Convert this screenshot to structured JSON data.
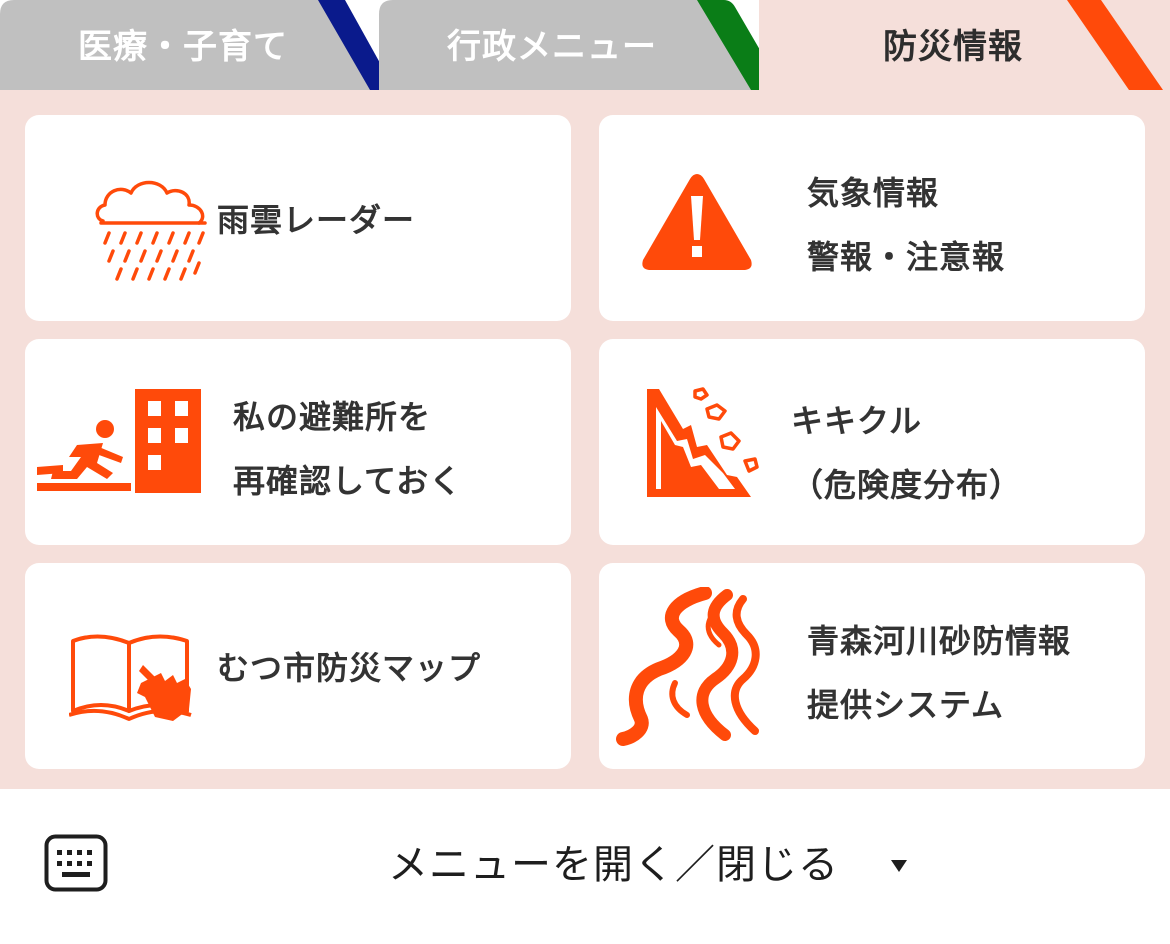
{
  "tabs": [
    {
      "label": "医療・子育て",
      "accent": "#0a1a8c",
      "active": false
    },
    {
      "label": "行政メニュー",
      "accent": "#0a7d17",
      "active": false
    },
    {
      "label": "防災情報",
      "accent": "#ff4a0a",
      "active": true
    }
  ],
  "colors": {
    "inactive_tab": "#c0c0c0",
    "active_tab": "#f5dfda",
    "panel_bg": "#f5dfda",
    "card_bg": "#ffffff",
    "icon": "#ff4a0a",
    "text": "#333333"
  },
  "cards": [
    {
      "icon": "rain-cloud-icon",
      "lines": [
        "雨雲レーダー"
      ]
    },
    {
      "icon": "warning-triangle-icon",
      "lines": [
        "気象情報",
        "警報・注意報"
      ]
    },
    {
      "icon": "evacuation-icon",
      "lines": [
        "私の避難所を",
        "再確認しておく"
      ]
    },
    {
      "icon": "landslide-icon",
      "lines": [
        "キキクル",
        "（危険度分布）"
      ]
    },
    {
      "icon": "map-book-icon",
      "lines": [
        "むつ市防災マップ"
      ]
    },
    {
      "icon": "river-icon",
      "lines": [
        "青森河川砂防情報",
        "提供システム"
      ]
    }
  ],
  "bottom_bar": {
    "icon": "keyboard-icon",
    "label": "メニューを開く／閉じる",
    "caret": "▾"
  }
}
